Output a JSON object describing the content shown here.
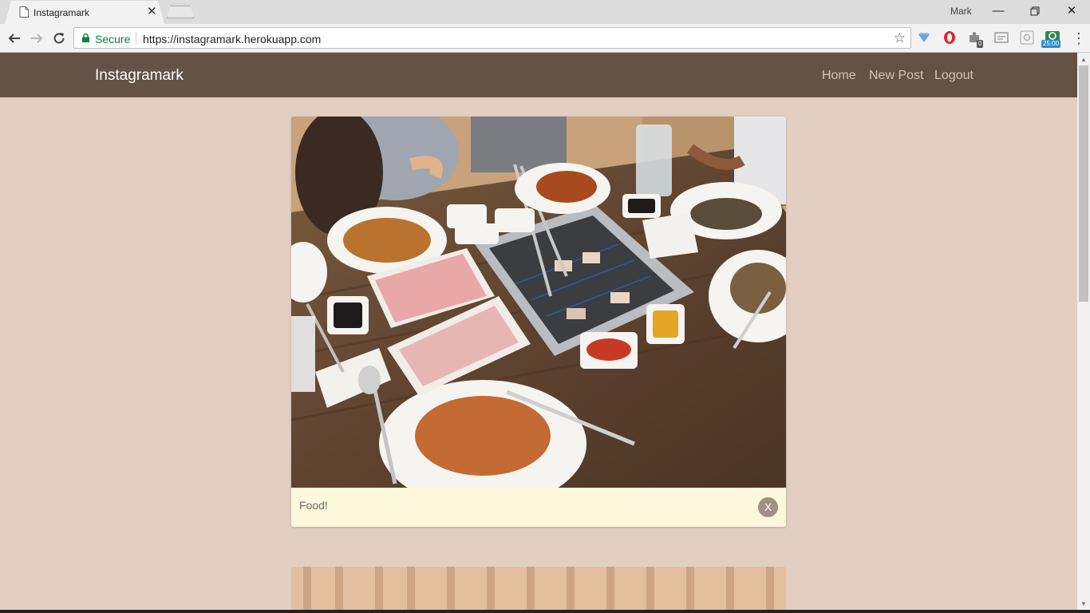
{
  "browser": {
    "tab_title": "Instagramark",
    "user": "Mark",
    "secure_label": "Secure",
    "url": "https://instagramark.herokuapp.com",
    "ext_badges": {
      "count": "0",
      "timer": "25:00"
    }
  },
  "navbar": {
    "brand": "Instagramark",
    "links": [
      {
        "label": "Home"
      },
      {
        "label": "New Post"
      },
      {
        "label": "Logout"
      }
    ]
  },
  "posts": [
    {
      "caption": "Food!",
      "delete_label": "X"
    }
  ],
  "colors": {
    "navbar": "#635245",
    "page_background": "#e2cfc2",
    "caption_background": "#fdf7dc",
    "delete_button": "#a18f80"
  }
}
